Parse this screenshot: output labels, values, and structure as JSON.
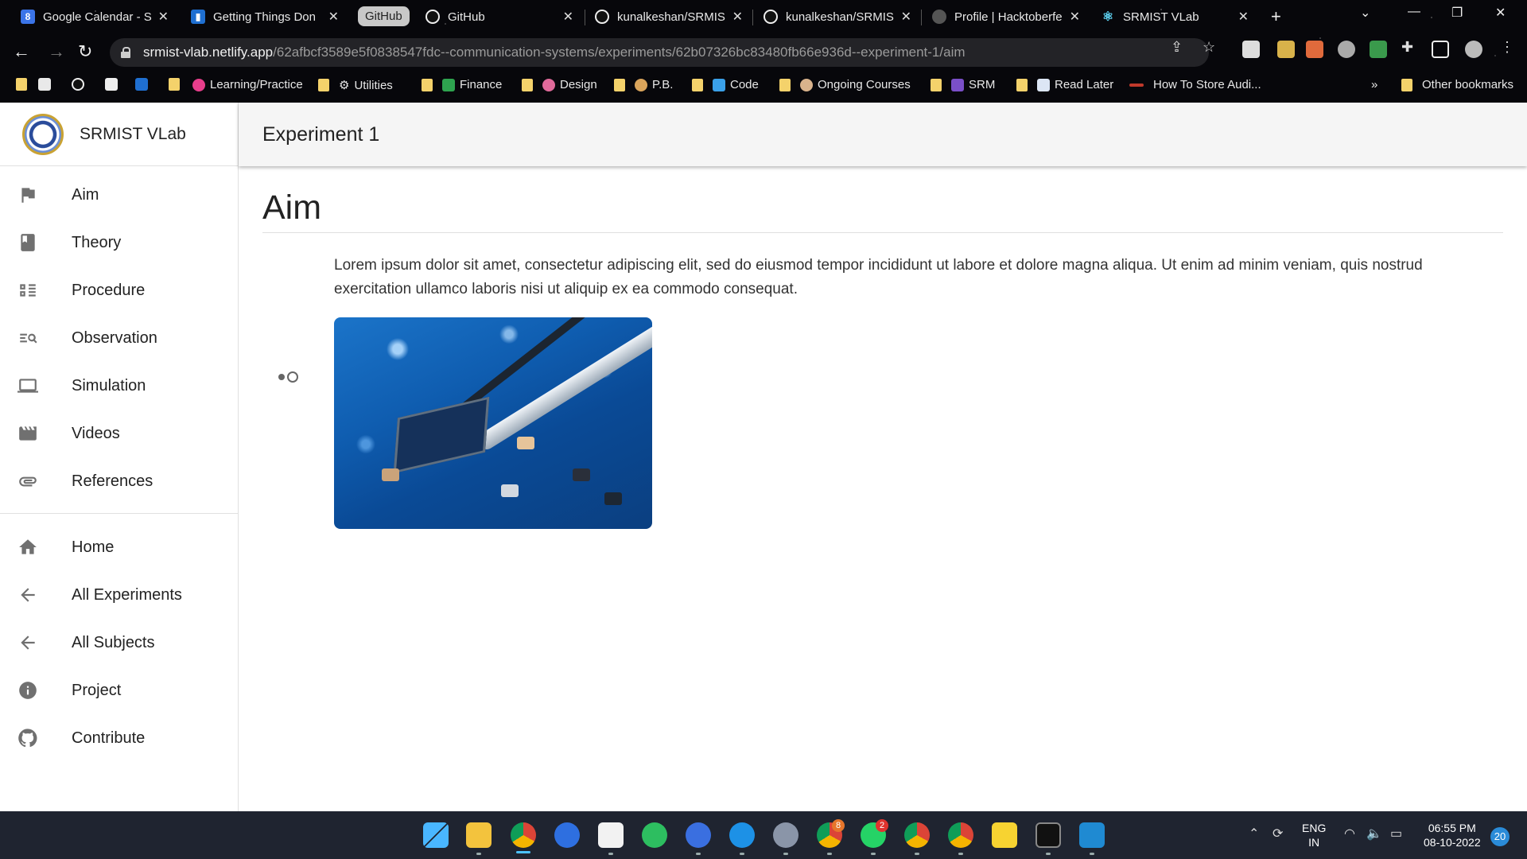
{
  "browser": {
    "group_label": "GitHub",
    "tabs": [
      {
        "label": "Google Calendar - S",
        "icon": "google-calendar-icon",
        "color": "#3b74e8"
      },
      {
        "label": "Getting Things Don",
        "icon": "trello-icon",
        "color": "#1f6fd1"
      },
      {
        "label": "GitHub",
        "icon": "github-icon",
        "color": "#111111"
      },
      {
        "label": "kunalkeshan/SRMIS",
        "icon": "github-icon",
        "color": "#111111"
      },
      {
        "label": "kunalkeshan/SRMIS",
        "icon": "github-icon",
        "color": "#111111"
      },
      {
        "label": "Profile | Hacktoberfe",
        "icon": "hacktoberfest-icon",
        "color": "#555555"
      },
      {
        "label": "SRMIST VLab",
        "icon": "react-icon",
        "color": "#61dafb"
      }
    ],
    "url_host": "srmist-vlab.netlify.app",
    "url_path": "/62afbcf3589e5f0838547fdc--communication-systems/experiments/62b07326bc83480fb66e936d--experiment-1/aim",
    "bookmarks": [
      {
        "label": "",
        "icon": "folder-icon"
      },
      {
        "label": "",
        "icon": "gmail-icon"
      },
      {
        "label": "",
        "icon": "github-icon"
      },
      {
        "label": "",
        "icon": "notion-icon"
      },
      {
        "label": "",
        "icon": "trello-icon"
      },
      {
        "label": "",
        "icon": "folder-icon"
      },
      {
        "label": "Learning/Practice",
        "icon": "brain-icon"
      },
      {
        "label": "Utilities",
        "icon": "gear-icon"
      },
      {
        "label": "Finance",
        "icon": "money-icon"
      },
      {
        "label": "Design",
        "icon": "palette-icon"
      },
      {
        "label": "P.B.",
        "icon": "face-icon"
      },
      {
        "label": "Code",
        "icon": "laptop-icon"
      },
      {
        "label": "Ongoing Courses",
        "icon": "hand-icon"
      },
      {
        "label": "SRM",
        "icon": "srm-icon"
      },
      {
        "label": "Read Later",
        "icon": "book-icon"
      },
      {
        "label": "How To Store Audi...",
        "icon": "link-icon"
      }
    ],
    "more_bookmarks": "»",
    "other_bookmarks": "Other bookmarks"
  },
  "app": {
    "brand": "SRMIST VLab",
    "title": "Experiment 1",
    "nav_primary": [
      {
        "label": "Aim",
        "icon": "flag-icon"
      },
      {
        "label": "Theory",
        "icon": "book-icon"
      },
      {
        "label": "Procedure",
        "icon": "procedure-icon"
      },
      {
        "label": "Observation",
        "icon": "observation-search-icon"
      },
      {
        "label": "Simulation",
        "icon": "laptop-icon"
      },
      {
        "label": "Videos",
        "icon": "movie-icon"
      },
      {
        "label": "References",
        "icon": "attachment-icon"
      }
    ],
    "nav_secondary": [
      {
        "label": "Home",
        "icon": "home-icon"
      },
      {
        "label": "All Experiments",
        "icon": "arrow-back-icon"
      },
      {
        "label": "All Subjects",
        "icon": "arrow-back-icon"
      },
      {
        "label": "Project",
        "icon": "info-icon"
      },
      {
        "label": "Contribute",
        "icon": "github-icon"
      }
    ],
    "page_heading": "Aim",
    "aim_text": "Lorem ipsum dolor sit amet, consectetur adipiscing elit, sed do eiusmod tempor incididunt ut labore et dolore magna aliqua. Ut enim ad minim veniam, quis nostrud exercitation ullamco laboris nisi ut aliquip ex ea commodo consequat."
  },
  "taskbar": {
    "apps": [
      "windows-start-icon",
      "file-explorer-icon",
      "chrome-icon",
      "firefox-icon",
      "notion-icon",
      "evernote-icon",
      "todo-icon",
      "docker-icon",
      "settings-icon",
      "chrome-icon",
      "whatsapp-icon",
      "chrome-icon",
      "chrome-icon",
      "sticky-notes-icon",
      "terminal-icon",
      "vscode-icon"
    ],
    "whatsapp_badge": "2",
    "chrome_badge": "8",
    "lang_top": "ENG",
    "lang_bottom": "IN",
    "time": "06:55 PM",
    "date": "08-10-2022",
    "notifications": "20"
  }
}
